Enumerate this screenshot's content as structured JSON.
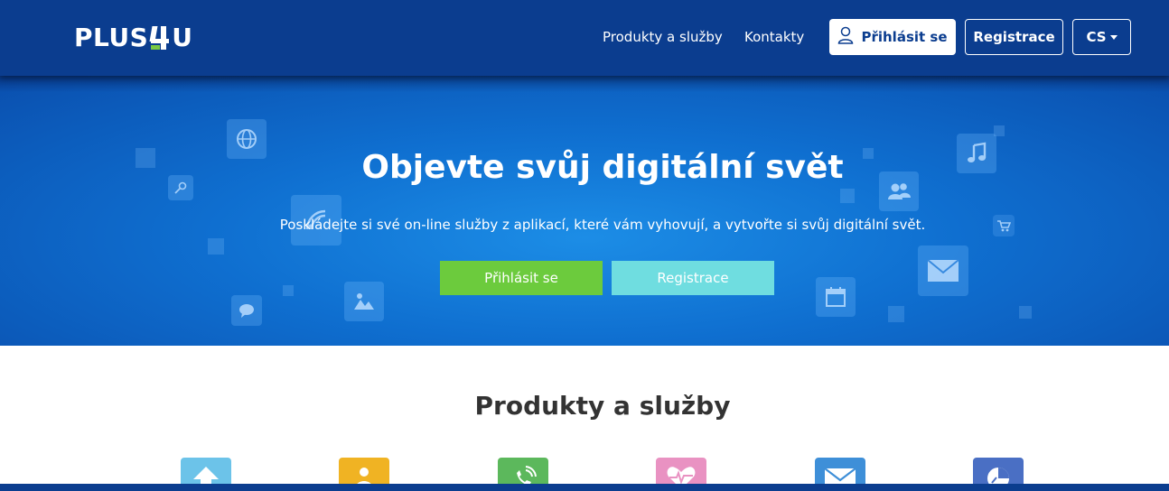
{
  "header": {
    "logo": "PLUS4U",
    "nav": {
      "products_label": "Produkty a služby",
      "contacts_label": "Kontakty"
    },
    "login_label": "Přihlásit se",
    "register_label": "Registrace",
    "language_label": "CS"
  },
  "hero": {
    "title": "Objevte svůj digitální svět",
    "subtitle": "Poskládejte si své on-line služby z aplikací, které vám vyhovují, a vytvořte si svůj digitální svět.",
    "login_label": "Přihlásit se",
    "register_label": "Registrace",
    "background_icons": [
      "globe-icon",
      "key-icon",
      "wifi-icon",
      "chat-icon",
      "image-icon",
      "music-icon",
      "users-icon",
      "cart-icon",
      "mail-icon",
      "calendar-icon"
    ]
  },
  "products": {
    "title": "Produkty a služby",
    "items": [
      {
        "icon": "cloud-upload-icon",
        "color": "#6cc3e9"
      },
      {
        "icon": "person-card-icon",
        "color": "#f0b323"
      },
      {
        "icon": "phone-icon",
        "color": "#5cb85c"
      },
      {
        "icon": "heart-pulse-icon",
        "color": "#e992c2"
      },
      {
        "icon": "mail-icon",
        "color": "#3e8fd8"
      },
      {
        "icon": "chart-icon",
        "color": "#4a6fc4"
      }
    ]
  },
  "colors": {
    "header_bg": "#0b3d8f",
    "login_green": "#6ccb3d",
    "register_cyan": "#6fdde0",
    "logo_accent": "#7ac943"
  }
}
